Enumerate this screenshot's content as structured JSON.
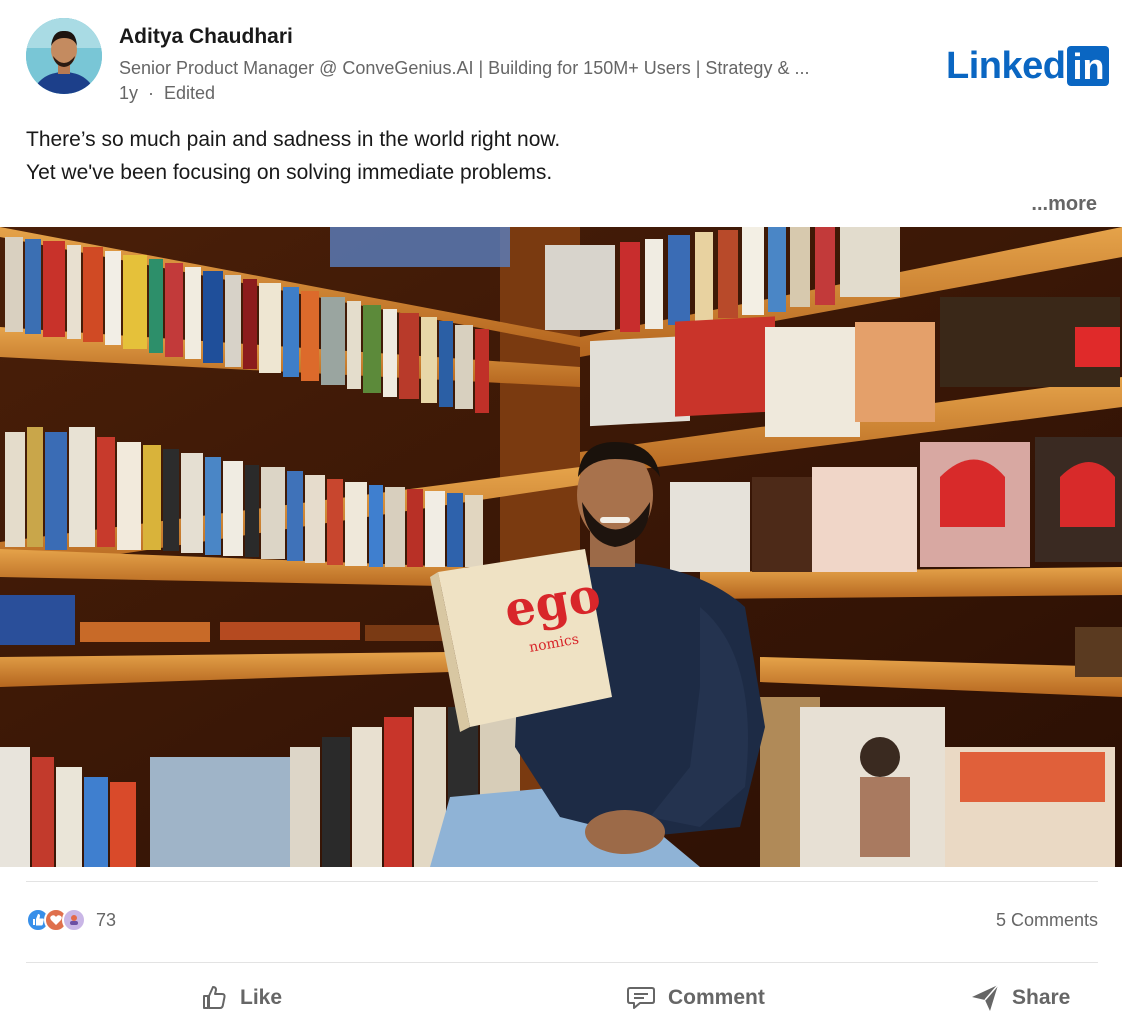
{
  "post": {
    "author": {
      "name": "Aditya Chaudhari",
      "headline": "Senior Product Manager @ ConveGenius.AI | Building for 150M+ Users | Strategy & ...",
      "time": "1y",
      "separator": "·",
      "edited": "Edited"
    },
    "brand": {
      "word": "Linked",
      "box": "in",
      "color": "#0a66c2"
    },
    "text_lines": [
      "There’s so much pain and sadness in the world right now.",
      "Yet we've been focusing on solving immediate problems."
    ],
    "more_label": "...more",
    "image": {
      "book_cover_title": "ego",
      "book_cover_subtitle": "nomics"
    }
  },
  "social": {
    "reaction_icons": [
      "like-icon",
      "love-icon",
      "support-icon"
    ],
    "reaction_count": "73",
    "comments": "5 Comments"
  },
  "actions": {
    "like": "Like",
    "comment": "Comment",
    "share": "Share"
  },
  "colors": {
    "muted_text": "#666666",
    "primary_text": "#191919",
    "divider": "#e3e3e3"
  }
}
